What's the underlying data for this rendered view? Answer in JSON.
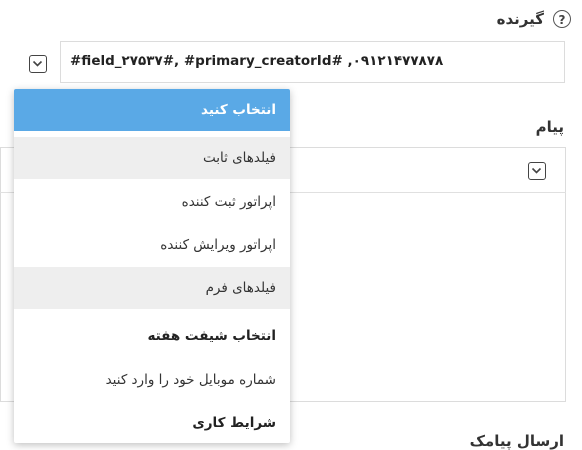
{
  "recipient": {
    "title": "گیرنده",
    "help_icon": "?",
    "value": "#field_۲۷۵۳۷#, #primary_creatorId# ,۰۹۱۲۱۴۷۷۸۷۸"
  },
  "message": {
    "title": "پیام"
  },
  "bottom_label": "ارسال پیامک",
  "dropdown": {
    "items": [
      {
        "label": "انتخاب کنید",
        "state": "selected"
      },
      {
        "label": "فیلدهای ثابت",
        "state": "group"
      },
      {
        "label": "اپراتور ثبت کننده",
        "state": "option"
      },
      {
        "label": "اپراتور ویرایش کننده",
        "state": "option"
      },
      {
        "label": "فیلدهای فرم",
        "state": "group"
      },
      {
        "label": "انتخاب شیفت هفته",
        "state": "bold"
      },
      {
        "label": "شماره موبایل خود را وارد کنید",
        "state": "option"
      },
      {
        "label": "شرایط کاری",
        "state": "bold"
      }
    ]
  },
  "colors": {
    "selected_bg": "#5aa9e6",
    "group_bg": "#eeeeee",
    "border": "#dcdcdc"
  }
}
